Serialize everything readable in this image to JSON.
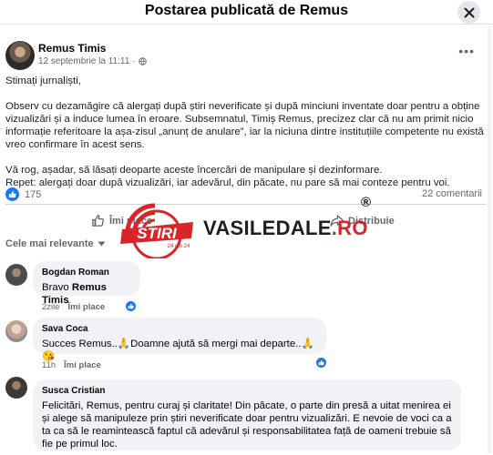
{
  "header": {
    "title": "Postarea publicată de Remus"
  },
  "post": {
    "author": "Remus Timis",
    "date": "12 septembrie la 11:11",
    "separator": "·",
    "greeting": "Stimați jurnaliști,",
    "paragraph1": "Observ cu dezamăgire că alergați după știri neverificate și după minciuni inventate doar pentru a obține vizualizări și a induce lumea în eroare. Subsemnatul, Timiș Remus, precizez clar că nu am primit nicio informație referitoare la așa-zisul „anunț de anulare”, iar la niciuna dintre instituțiile competente nu există vreo confirmare în acest sens.",
    "paragraph2_line1": "Vă rog, așadar, să lăsați deoparte aceste încercări de manipulare și dezinformare.",
    "paragraph2_line2": "Repet: alergați doar după vizualizări, iar adevărul, din păcate, nu pare să mai conteze pentru voi.",
    "reaction_count": "175",
    "comments_count": "22 comentarii",
    "like_label": "Îmi place",
    "share_label": "Distribuie"
  },
  "watermark": {
    "logo_text": "STIRI",
    "logo_sub": "24 din 24",
    "site_main": "VASILEDALE",
    "site_tld": ".RO",
    "registered": "®"
  },
  "comments_section": {
    "sort_label": "Cele mai relevante"
  },
  "comments": [
    {
      "name": "Bogdan Roman",
      "text_prefix": "Bravo ",
      "text_bold": "Remus Timis",
      "time": "2zile",
      "like_label": "Îmi place"
    },
    {
      "name": "Sava Coca",
      "text": "Succes Remus..🙏Doamne ajută să mergi mai departe..🙏😘",
      "time": "11h",
      "like_label": "Îmi place"
    },
    {
      "name": "Susca Cristian",
      "text": "Felicitări, Remus, pentru curaj și claritate! Din păcate, o parte din presă a uitat menirea ei și alege să manipuleze prin știri neverificate doar pentru vizualizări. E nevoie de voci ca a ta ca să le reamintească faptul că adevărul și responsabilitatea față de oameni trebuie să fie pe primul loc."
    }
  ],
  "colors": {
    "facebook_blue": "#1877f2",
    "watermark_red": "#d9242a",
    "bubble_bg": "#f0f2f5",
    "muted_text": "#65676b"
  },
  "icons": [
    "close-icon",
    "globe-icon",
    "more-icon",
    "like-icon",
    "thumbs-up-icon",
    "share-icon",
    "caret-down-icon"
  ]
}
